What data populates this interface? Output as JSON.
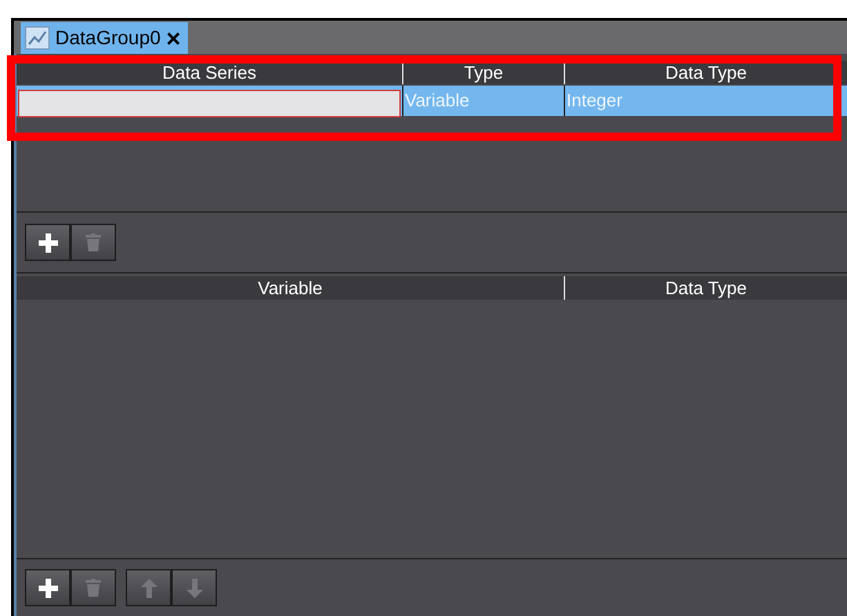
{
  "tab": {
    "title": "DataGroup0",
    "close": "×",
    "selected": true
  },
  "series_table": {
    "highlighted": true,
    "columns": [
      "Data Series",
      "Type",
      "Data Type"
    ],
    "rows": [
      {
        "cells": [
          "",
          "Variable",
          "Integer"
        ],
        "selected": true
      }
    ]
  },
  "series_toolbar": [
    {
      "kind": "add",
      "disabled": false
    },
    {
      "kind": "delete",
      "disabled": true
    }
  ],
  "variable_table": {
    "columns": [
      "Variable",
      "Data Type"
    ]
  },
  "variable_toolbar": [
    {
      "kind": "add",
      "disabled": false
    },
    {
      "kind": "delete",
      "disabled": true
    },
    {
      "kind": "up",
      "disabled": true
    },
    {
      "kind": "down",
      "disabled": true
    }
  ]
}
